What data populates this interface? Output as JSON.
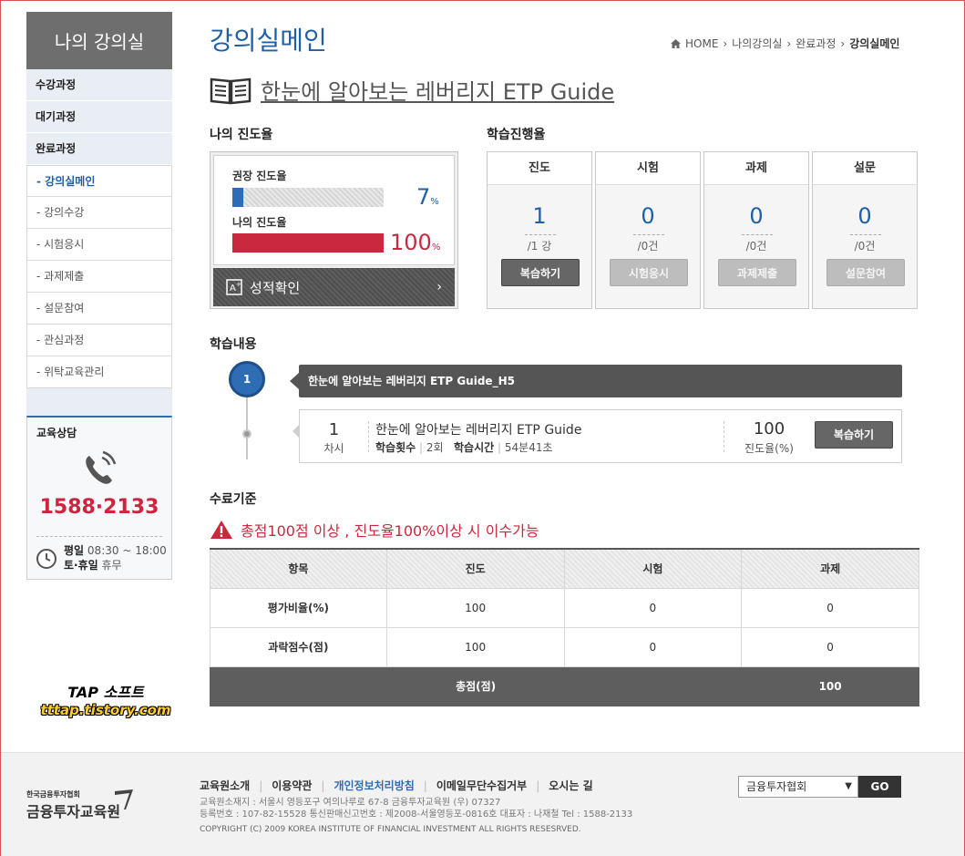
{
  "sidebar": {
    "title": "나의 강의실",
    "main_items": [
      "수강과정",
      "대기과정",
      "완료과정"
    ],
    "sub_items": [
      "- 강의실메인",
      "- 강의수강",
      "- 시험응시",
      "- 과제제출",
      "- 설문참여",
      "- 관심과정",
      "- 위탁교육관리"
    ],
    "active_sub": "- 강의실메인",
    "consult": {
      "title": "교육상담",
      "phone": "1588·2133",
      "weekday_label": "평일",
      "weekday_hours": "08:30 ~ 18:00",
      "weekend_label": "토·휴일",
      "weekend_hours": "휴무"
    }
  },
  "watermark": {
    "line1": "TAP 소프트",
    "line2": "tttap.tistory.com"
  },
  "header": {
    "page_title": "강의실메인",
    "breadcrumb": [
      "HOME",
      "나의강의실",
      "완료과정",
      "강의실메인"
    ],
    "course_title": "한눈에 알아보는 레버리지 ETP Guide"
  },
  "my_progress": {
    "heading": "나의 진도율",
    "recommended_label": "권장 진도율",
    "recommended_value": "7",
    "recommended_fraction": 0.07,
    "mine_label": "나의 진도율",
    "mine_value": "100",
    "mine_fraction": 1.0,
    "unit": "%",
    "grade_button": "성적확인"
  },
  "learning_rate": {
    "heading": "학습진행율",
    "columns": [
      {
        "label": "진도",
        "value": "1",
        "total": "/1 강",
        "button": "복습하기",
        "enabled": true
      },
      {
        "label": "시험",
        "value": "0",
        "total": "/0건",
        "button": "시험응시",
        "enabled": false
      },
      {
        "label": "과제",
        "value": "0",
        "total": "/0건",
        "button": "과제제출",
        "enabled": false
      },
      {
        "label": "설문",
        "value": "0",
        "total": "/0건",
        "button": "설문참여",
        "enabled": false
      }
    ]
  },
  "content": {
    "heading": "학습내용",
    "step": "1",
    "module_title": "한눈에 알아보는 레버리지 ETP Guide_H5",
    "lesson": {
      "session_no": "1",
      "session_label": "차시",
      "title": "한눈에 알아보는 레버리지 ETP Guide",
      "count_label": "학습횟수",
      "count_value": "2회",
      "time_label": "학습시간",
      "time_value": "54분41초",
      "progress_value": "100",
      "progress_label": "진도율(%)",
      "button": "복습하기"
    }
  },
  "criteria": {
    "heading": "수료기준",
    "warning": "총점100점 이상 , 진도율100%이상 시 이수가능",
    "headers": [
      "항목",
      "진도",
      "시험",
      "과제"
    ],
    "rows": [
      [
        "평가비율(%)",
        "100",
        "0",
        "0"
      ],
      [
        "과락점수(점)",
        "100",
        "0",
        "0"
      ]
    ],
    "total_label": "총점(점)",
    "total_value": "100"
  },
  "footer": {
    "logo_small": "한국금융투자협회",
    "logo_large": "금융투자교육원",
    "links": [
      "교육원소개",
      "이용약관",
      "개인정보처리방침",
      "이메일무단수집거부",
      "오시는 길"
    ],
    "info_line1": "교육원소재지 : 서울시 영등포구 여의나루로 67-8 금융투자교육원 (우) 07327",
    "info_line2": "등록번호 : 107-82-15528 통신판매신고번호 : 제2008-서울영등포-0816호 대표자 : 나재철  Tel : 1588-2133",
    "copyright": "COPYRIGHT (C) 2009 KOREA INSTITUTE OF FINANCIAL INVESTMENT ALL RIGHTS RESESRVED.",
    "select_value": "금융투자협회",
    "go_label": "GO"
  }
}
